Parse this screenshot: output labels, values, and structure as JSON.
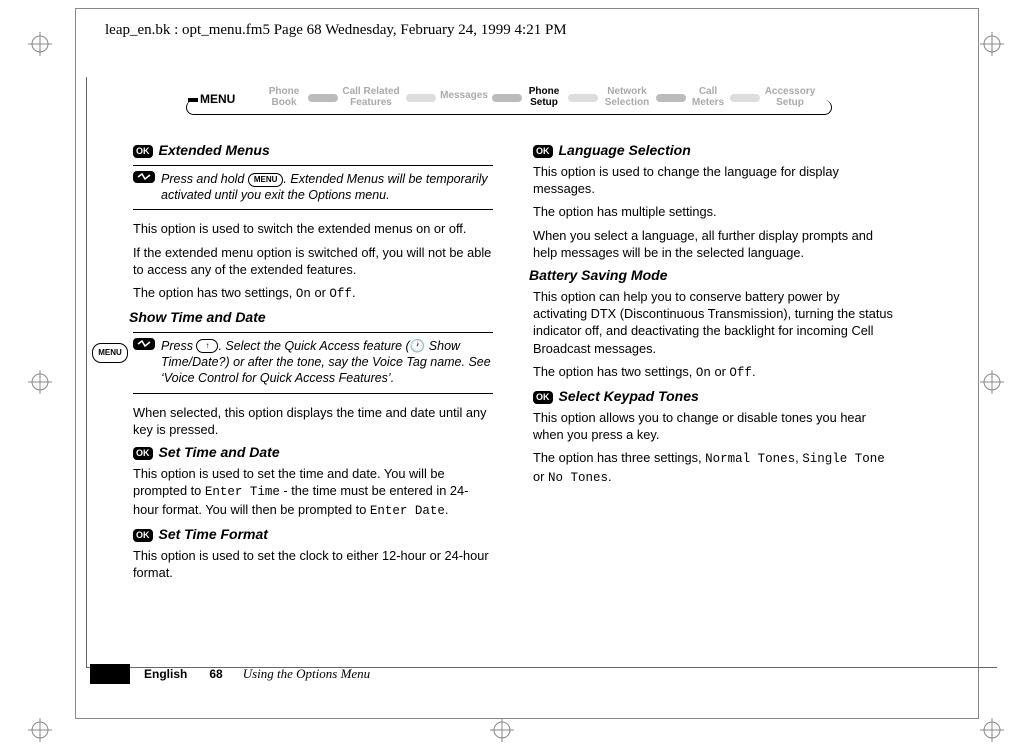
{
  "running_head": "leap_en.bk : opt_menu.fm5  Page 68  Wednesday, February 24, 1999  4:21 PM",
  "menu_bar": {
    "lead": "MENU",
    "items": [
      {
        "line1": "Phone",
        "line2": "Book",
        "active": false
      },
      {
        "line1": "Call Related",
        "line2": "Features",
        "active": false
      },
      {
        "line1": "Messages",
        "line2": "",
        "active": false
      },
      {
        "line1": "Phone",
        "line2": "Setup",
        "active": true
      },
      {
        "line1": "Network",
        "line2": "Selection",
        "active": false
      },
      {
        "line1": "Call",
        "line2": "Meters",
        "active": false
      },
      {
        "line1": "Accessory",
        "line2": "Setup",
        "active": false
      }
    ]
  },
  "left_col": {
    "h_extended": "Extended Menus",
    "ok_label": "OK",
    "tip1_a": "Press and hold ",
    "tip1_key": "MENU",
    "tip1_b": ". Extended Menus will be temporarily activated until you exit the Options menu.",
    "p_ext1": "This option is used to switch the extended menus on or off.",
    "p_ext2": "If the extended menu option is switched off, you will not be able to access any of the extended features.",
    "p_ext3a": "The option has two settings, ",
    "p_ext3_on": "On",
    "p_ext3_mid": " or ",
    "p_ext3_off": "Off",
    "p_ext3_end": ".",
    "h_showtd": "Show Time and Date",
    "tip2_a": "Press ",
    "tip2_key": "↑",
    "tip2_b": ". Select the Quick Access feature (",
    "tip2_c": " Show Time/Date?) or after the tone, say the Voice Tag name. See ‘Voice Control for Quick Access Features’.",
    "p_show1": "When selected, this option displays the time and date until any key is pressed.",
    "h_settd": "Set Time and Date",
    "p_settd_a": "This option is used to set the time and date. You will be prompted to ",
    "p_settd_entertime": "Enter Time",
    "p_settd_b": " - the time must be entered in 24-hour format. You will then be prompted to ",
    "p_settd_enterdate": "Enter Date",
    "p_settd_c": ".",
    "h_setfmt": "Set Time Format",
    "p_setfmt": "This option is used to set the clock to either 12-hour or 24-hour format."
  },
  "right_col": {
    "h_lang": "Language Selection",
    "p_lang1": "This option is used to change the language for display messages.",
    "p_lang2": "The option has multiple settings.",
    "p_lang3": "When you select a language, all further display prompts and help messages will be in the selected language.",
    "h_batt": "Battery Saving Mode",
    "p_batt1": "This option can help you to conserve battery power by activating DTX (Discontinuous Transmission), turning the status indicator off, and deactivating the backlight for incoming Cell Broadcast messages.",
    "p_batt2a": "The option has two settings, ",
    "p_batt2_on": "On",
    "p_batt2_mid": " or ",
    "p_batt2_off": "Off",
    "p_batt2_end": ".",
    "h_keypad": "Select Keypad Tones",
    "p_key1": "This option allows you to change or disable tones you hear when you press a key.",
    "p_key2a": "The option has three settings, ",
    "p_key2_normal": "Normal Tones",
    "p_key2_sep1": ", ",
    "p_key2_single": "Single Tone",
    "p_key2_sep2": " or ",
    "p_key2_no": "No Tones",
    "p_key2_end": "."
  },
  "margin_icon_label": "MENU",
  "footer": {
    "language": "English",
    "page_number": "68",
    "section": "Using the Options Menu"
  }
}
